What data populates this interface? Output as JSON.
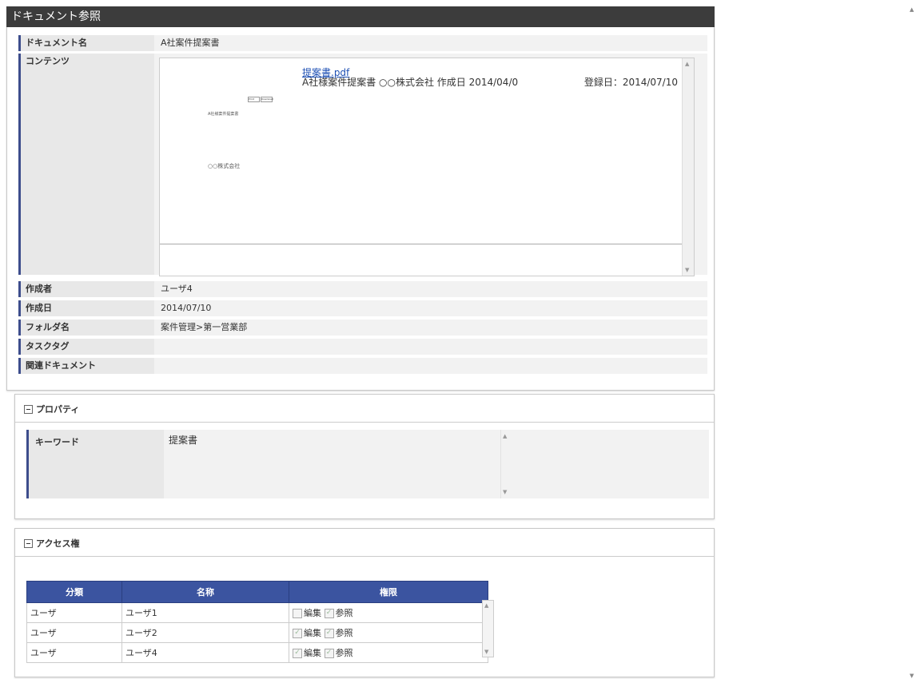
{
  "title": "ドキュメント参照",
  "doc": {
    "name_label": "ドキュメント名",
    "name_value": "A社案件提案書",
    "content_label": "コンテンツ",
    "pdf": {
      "filename": "提案書.pdf",
      "description": "A社様案件提案書 ○○株式会社 作成日 2014/04/0",
      "registered": "登録日：2014/07/10",
      "thumb_btns": [
        "Print",
        "Download"
      ],
      "thumb_title": "A社様案件提案書",
      "thumb_company": "○○株式会社"
    },
    "author_label": "作成者",
    "author_value": "ユーザ4",
    "created_label": "作成日",
    "created_value": "2014/07/10",
    "folder_label": "フォルダ名",
    "folder_value": "案件管理>第一営業部",
    "tag_label": "タスクタグ",
    "tag_value": "",
    "related_label": "関連ドキュメント",
    "related_value": ""
  },
  "property": {
    "title": "プロパティ",
    "keyword_label": "キーワード",
    "keyword_value": "提案書"
  },
  "access": {
    "title": "アクセス権",
    "headers": [
      "分類",
      "名称",
      "権限"
    ],
    "edit_label": "編集",
    "view_label": "参照",
    "rows": [
      {
        "type": "ユーザ",
        "name": "ユーザ1",
        "edit": false,
        "view": true
      },
      {
        "type": "ユーザ",
        "name": "ユーザ2",
        "edit": true,
        "view": true
      },
      {
        "type": "ユーザ",
        "name": "ユーザ4",
        "edit": true,
        "view": true
      }
    ]
  }
}
